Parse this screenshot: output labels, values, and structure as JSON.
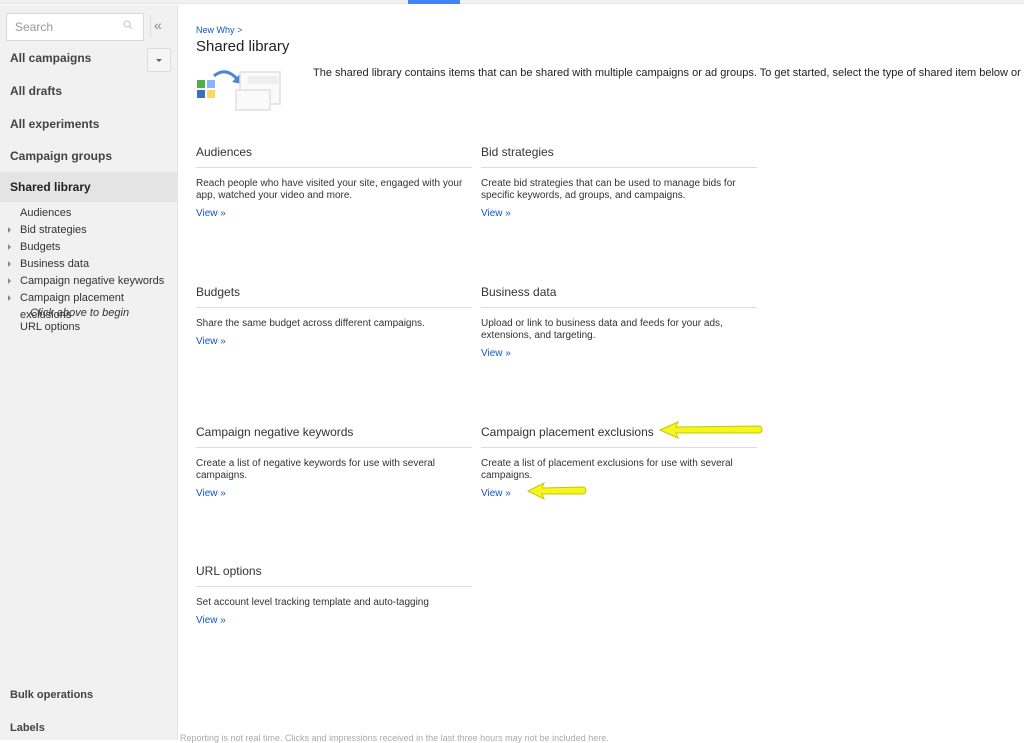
{
  "sidebar": {
    "search_placeholder": "Search",
    "collapse_icon": "«",
    "nav": [
      {
        "label": "All campaigns"
      },
      {
        "label": "All drafts"
      },
      {
        "label": "All experiments"
      },
      {
        "label": "Campaign groups"
      },
      {
        "label": "Shared library"
      }
    ],
    "sub_items": [
      {
        "label": "Audiences",
        "expandable": false
      },
      {
        "label": "Bid strategies",
        "expandable": true
      },
      {
        "label": "Budgets",
        "expandable": true
      },
      {
        "label": "Business data",
        "expandable": true
      },
      {
        "label": "Campaign negative keywords",
        "expandable": true
      },
      {
        "label": "Campaign placement exclusions",
        "expandable": true
      }
    ],
    "hint": "Click above to begin",
    "url_options": "URL options",
    "bottom": [
      {
        "label": "Bulk operations"
      },
      {
        "label": "Labels"
      }
    ]
  },
  "main": {
    "breadcrumb": "New Why",
    "breadcrumb_sep": ">",
    "title": "Shared library",
    "intro": "The shared library contains items that can be shared with multiple campaigns or ad groups. To get started, select the type of shared item below or from the left",
    "view_label": "View »",
    "cards": [
      {
        "title": "Audiences",
        "desc": "Reach people who have visited your site, engaged with your app, watched your video and more."
      },
      {
        "title": "Bid strategies",
        "desc": "Create bid strategies that can be used to manage bids for specific keywords, ad groups, and campaigns."
      },
      {
        "title": "Budgets",
        "desc": "Share the same budget across different campaigns."
      },
      {
        "title": "Business data",
        "desc": "Upload or link to business data and feeds for your ads, extensions, and targeting."
      },
      {
        "title": "Campaign negative keywords",
        "desc": "Create a list of negative keywords for use with several campaigns."
      },
      {
        "title": "Campaign placement exclusions",
        "desc": "Create a list of placement exclusions for use with several campaigns."
      },
      {
        "title": "URL options",
        "desc": "Set account level tracking template and auto-tagging"
      }
    ],
    "footer": "Reporting is not real time. Clicks and impressions received in the last three hours may not be included here."
  },
  "colors": {
    "link": "#1155cc",
    "accent": "#4285f4",
    "annotation": "#f5f520"
  }
}
